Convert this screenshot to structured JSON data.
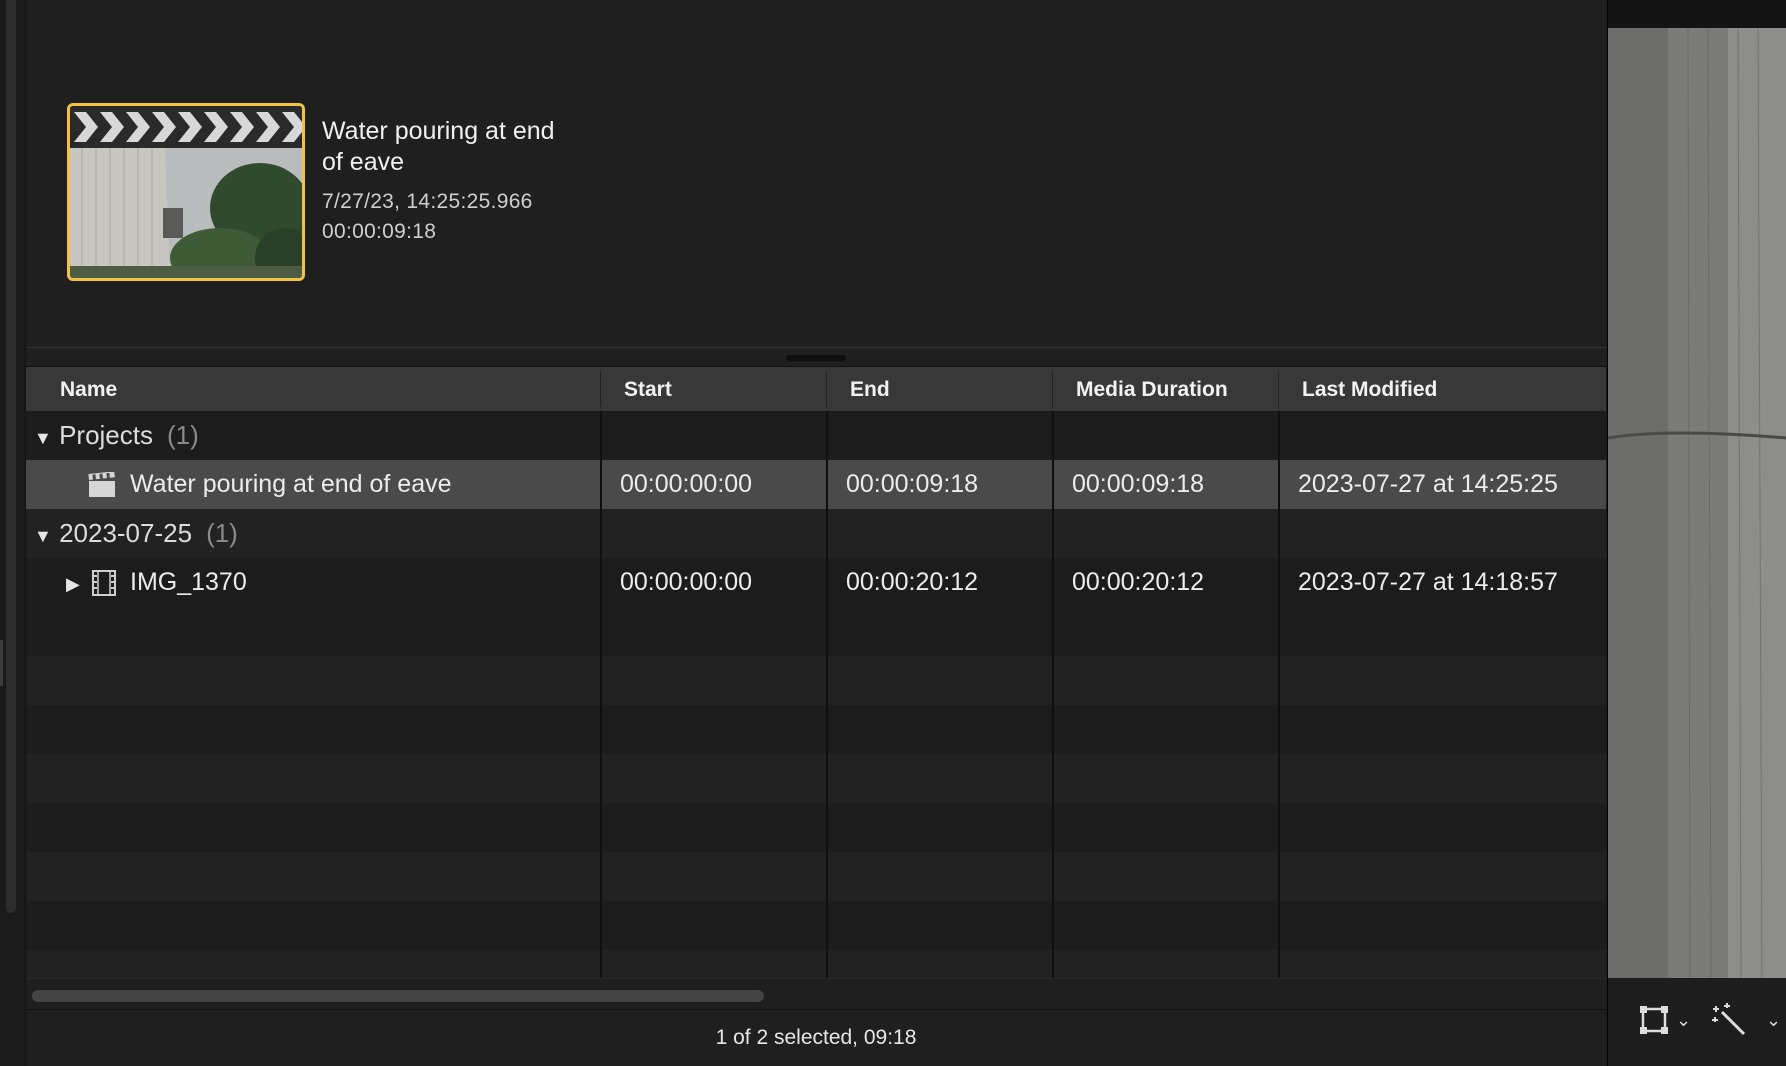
{
  "clip": {
    "title": "Water pouring at end of eave",
    "date": "7/27/23, 14:25:25.966",
    "duration": "00:00:09:18"
  },
  "columns": {
    "name": "Name",
    "start": "Start",
    "end": "End",
    "media_duration": "Media Duration",
    "last_modified": "Last Modified"
  },
  "groups": [
    {
      "title": "Projects",
      "count": "(1)",
      "items": [
        {
          "name": "Water pouring at end of eave",
          "start": "00:00:00:00",
          "end": "00:00:09:18",
          "media_duration": "00:00:09:18",
          "last_modified": "2023-07-27 at 14:25:25",
          "icon": "clapperboard-icon",
          "selected": true
        }
      ]
    },
    {
      "title": "2023-07-25",
      "count": "(1)",
      "items": [
        {
          "name": "IMG_1370",
          "start": "00:00:00:00",
          "end": "00:00:20:12",
          "media_duration": "00:00:20:12",
          "last_modified": "2023-07-27 at 14:18:57",
          "icon": "film-icon",
          "selected": false
        }
      ]
    }
  ],
  "status": "1 of 2 selected, 09:18",
  "colors": {
    "selection_border": "#f2c240",
    "selected_row": "#4a4a4a"
  }
}
